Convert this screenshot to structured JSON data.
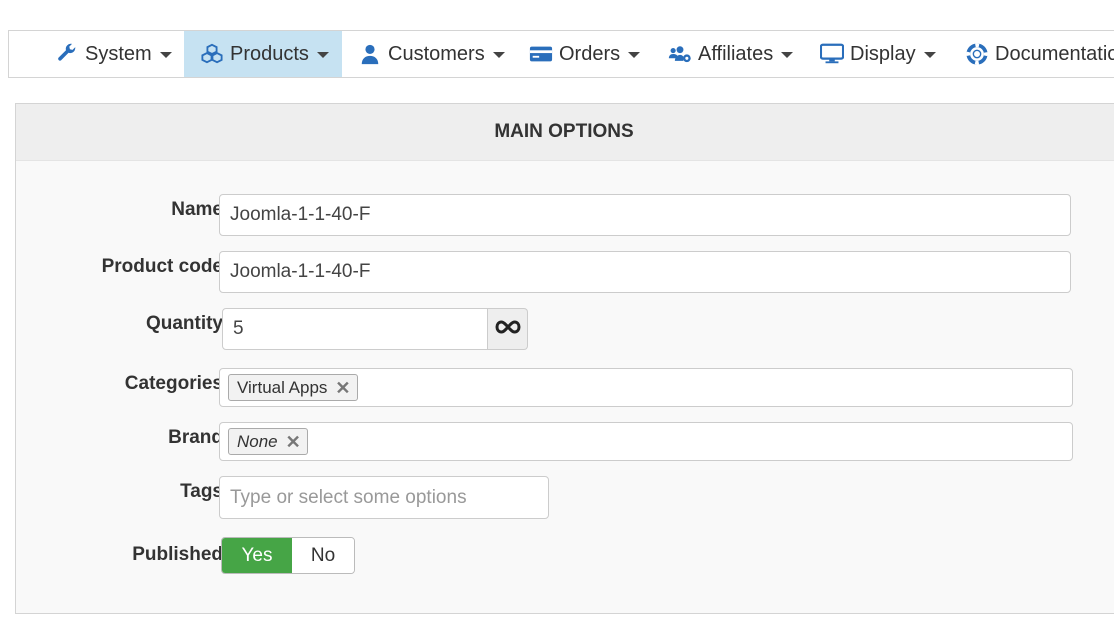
{
  "nav": {
    "items": [
      {
        "label": "System",
        "icon": "wrench-icon"
      },
      {
        "label": "Products",
        "icon": "cubes-icon",
        "active": true
      },
      {
        "label": "Customers",
        "icon": "user-icon"
      },
      {
        "label": "Orders",
        "icon": "credit-card-icon"
      },
      {
        "label": "Affiliates",
        "icon": "users-cog-icon"
      },
      {
        "label": "Display",
        "icon": "desktop-icon"
      },
      {
        "label": "Documentation",
        "icon": "life-ring-icon"
      }
    ]
  },
  "panel": {
    "title": "MAIN OPTIONS"
  },
  "form": {
    "name": {
      "label": "Name",
      "value": "Joomla-1-1-40-F"
    },
    "product_code": {
      "label": "Product code",
      "value": "Joomla-1-1-40-F"
    },
    "quantity": {
      "label": "Quantity",
      "value": "5",
      "addon_icon": "infinity-icon"
    },
    "categories": {
      "label": "Categories",
      "chips": [
        "Virtual Apps"
      ]
    },
    "brand": {
      "label": "Brand",
      "chips": [
        "None"
      ]
    },
    "tags": {
      "label": "Tags",
      "placeholder": "Type or select some options"
    },
    "published": {
      "label": "Published",
      "yes": "Yes",
      "no": "No",
      "selected": "Yes"
    }
  },
  "colors": {
    "accent": "#2a6ebb",
    "active_nav_bg": "#c6e2f2",
    "toggle_on": "#46a546"
  }
}
